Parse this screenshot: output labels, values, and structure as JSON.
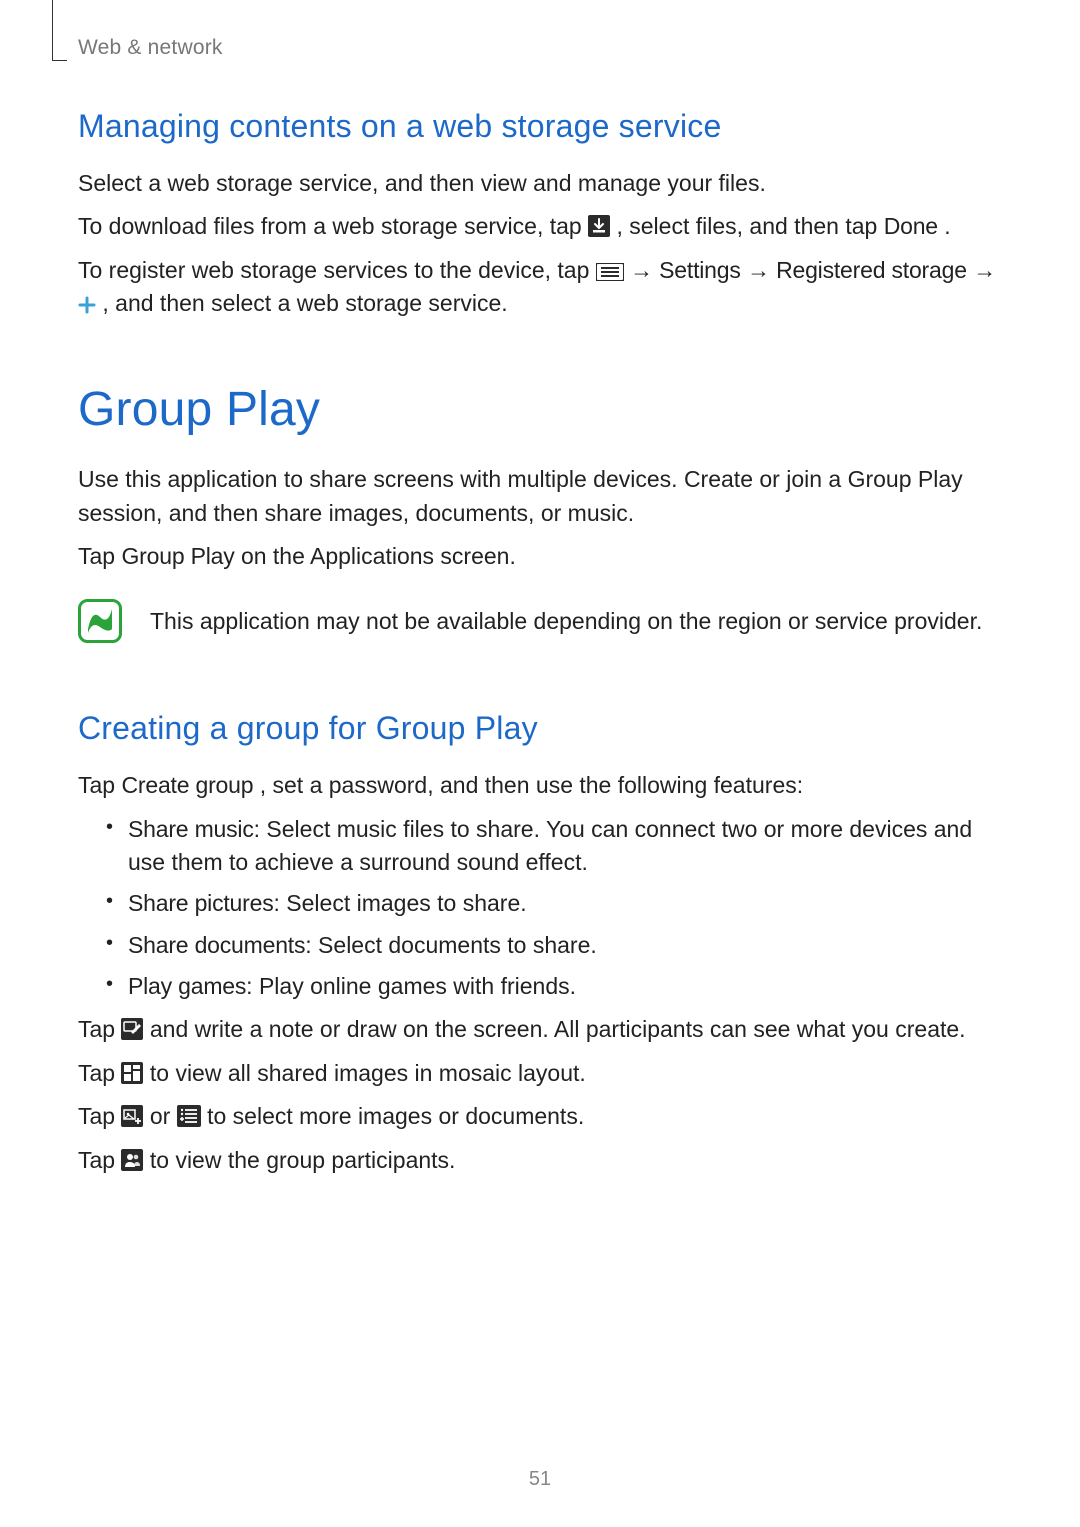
{
  "header": {
    "section_label": "Web & network"
  },
  "section1": {
    "heading": "Managing contents on a web storage service",
    "p1": "Select a web storage service, and then view and manage your files.",
    "p2_a": "To download files from a web storage service, tap ",
    "p2_b": ", select files, and then tap ",
    "p2_done": "Done",
    "p2_c": ".",
    "p3_a": "To register web storage services to the device, tap ",
    "p3_arrow1": " → ",
    "p3_settings": "Settings",
    "p3_arrow2": " → ",
    "p3_regstorage": "Registered storage",
    "p3_arrow3": " → ",
    "p3_b": ", and then select a web storage service."
  },
  "group_play": {
    "title": "Group Play",
    "intro": "Use this application to share screens with multiple devices. Create or join a Group Play session, and then share images, documents, or music.",
    "tap_a": "Tap ",
    "tap_term": "Group Play",
    "tap_b": " on the Applications screen.",
    "note": "This application may not be available depending on the region or service provider."
  },
  "creating": {
    "heading": "Creating a group for Group Play",
    "p1_a": "Tap ",
    "p1_term": "Create group",
    "p1_b": ", set a password, and then use the following features:",
    "items": [
      {
        "term": "Share music",
        "desc": ": Select music files to share. You can connect two or more devices and use them to achieve a surround sound effect."
      },
      {
        "term": "Share pictures",
        "desc": ": Select images to share."
      },
      {
        "term": "Share documents",
        "desc": ": Select documents to share."
      },
      {
        "term": "Play games",
        "desc": ": Play online games with friends."
      }
    ],
    "line1_a": "Tap ",
    "line1_b": " and write a note or draw on the screen. All participants can see what you create.",
    "line2_a": "Tap ",
    "line2_b": " to view all shared images in mosaic layout.",
    "line3_a": "Tap ",
    "line3_or": " or ",
    "line3_b": " to select more images or documents.",
    "line4_a": "Tap ",
    "line4_b": " to view the group participants."
  },
  "page_number": "51"
}
